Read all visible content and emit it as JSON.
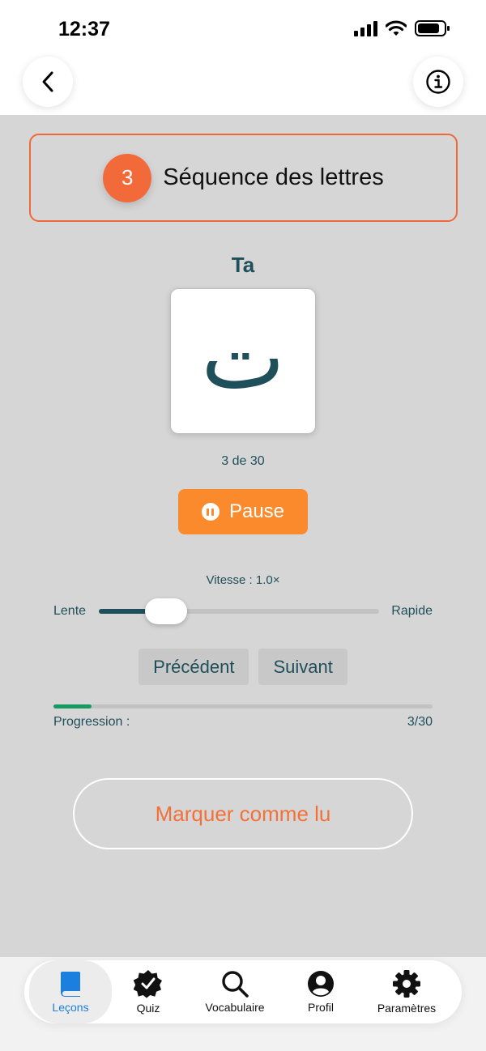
{
  "status_bar": {
    "time": "12:37"
  },
  "lesson": {
    "number": "3",
    "title": "Séquence des lettres"
  },
  "letter": {
    "name": "Ta",
    "glyph": "ت",
    "counter": "3 de 30"
  },
  "playback": {
    "button_label": "Pause"
  },
  "speed": {
    "label": "Vitesse : 1.0×",
    "min_label": "Lente",
    "max_label": "Rapide",
    "value_fraction": 0.24
  },
  "navigation": {
    "previous_label": "Précédent",
    "next_label": "Suivant"
  },
  "progress": {
    "label": "Progression :",
    "count": "3/30",
    "current": 3,
    "total": 30
  },
  "mark_read": {
    "label": "Marquer comme lu"
  },
  "tabs": [
    {
      "label": "Leçons",
      "icon": "book-icon",
      "active": true
    },
    {
      "label": "Quiz",
      "icon": "verified-badge-icon",
      "active": false
    },
    {
      "label": "Vocabulaire",
      "icon": "search-icon",
      "active": false
    },
    {
      "label": "Profil",
      "icon": "profile-icon",
      "active": false
    },
    {
      "label": "Paramètres",
      "icon": "gear-icon",
      "active": false
    }
  ],
  "colors": {
    "accent": "#f26a3a",
    "primary": "#1f4f5a",
    "pause_button": "#fa8a2c",
    "progress": "#159a62",
    "active_tab": "#1b7fe0"
  }
}
